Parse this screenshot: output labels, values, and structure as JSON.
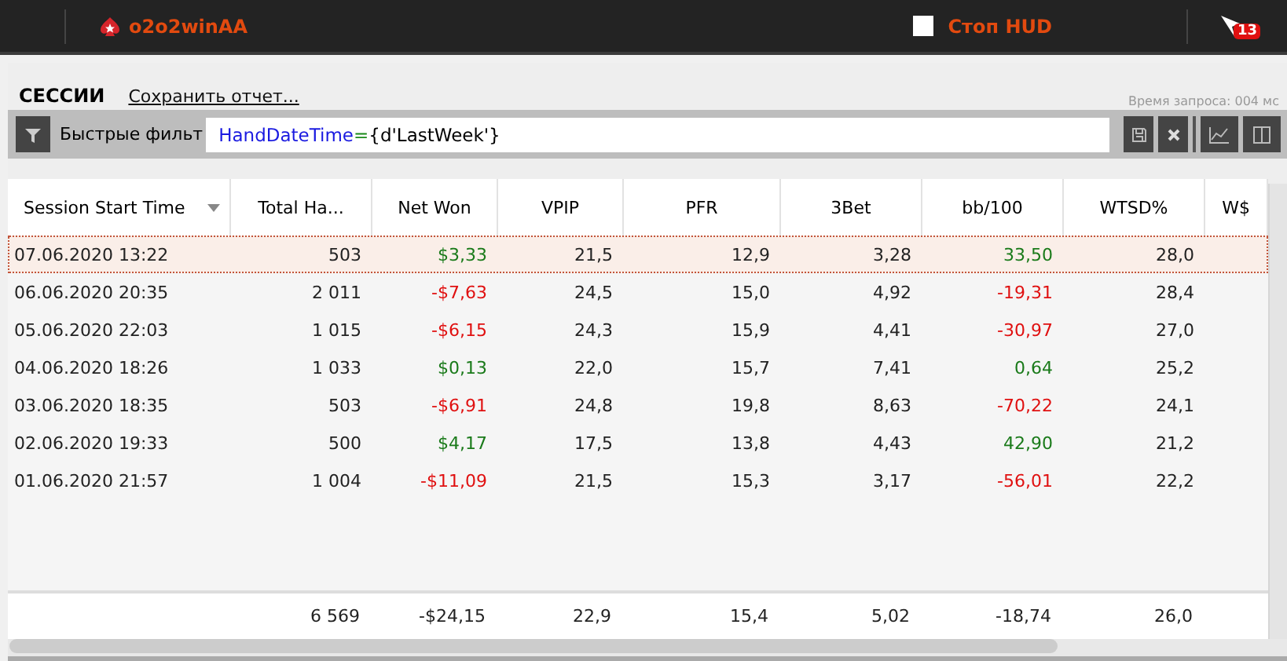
{
  "top_bar": {
    "account": "o2o2winAA",
    "hud_checked": false,
    "hud_label": "Стоп HUD",
    "notification_count": "13"
  },
  "header": {
    "title": "СЕССИИ",
    "save_link": "Сохранить отчет...",
    "query_time": "Время запроса: 004 мс"
  },
  "filter": {
    "label": "Быстрые фильт",
    "field": "HandDateTime",
    "operator": "=",
    "value": "{d'LastWeek'}"
  },
  "table": {
    "columns": [
      {
        "label": "Session Start Time",
        "sorted": true
      },
      {
        "label": "Total Ha...",
        "sorted": false
      },
      {
        "label": "Net Won",
        "sorted": false
      },
      {
        "label": "VPIP",
        "sorted": false
      },
      {
        "label": "PFR",
        "sorted": false
      },
      {
        "label": "3Bet",
        "sorted": false
      },
      {
        "label": "bb/100",
        "sorted": false
      },
      {
        "label": "WTSD%",
        "sorted": false
      },
      {
        "label": "W$",
        "sorted": false
      }
    ],
    "rows": [
      {
        "selected": true,
        "cells": [
          {
            "text": "07.06.2020 13:22"
          },
          {
            "text": "503"
          },
          {
            "text": "$3,33",
            "negative": false
          },
          {
            "text": "21,5"
          },
          {
            "text": "12,9"
          },
          {
            "text": "3,28"
          },
          {
            "text": "33,50",
            "negative": false
          },
          {
            "text": "28,0"
          }
        ]
      },
      {
        "selected": false,
        "cells": [
          {
            "text": "06.06.2020 20:35"
          },
          {
            "text": "2 011"
          },
          {
            "text": "-$7,63",
            "negative": true
          },
          {
            "text": "24,5"
          },
          {
            "text": "15,0"
          },
          {
            "text": "4,92"
          },
          {
            "text": "-19,31",
            "negative": true
          },
          {
            "text": "28,4"
          }
        ]
      },
      {
        "selected": false,
        "cells": [
          {
            "text": "05.06.2020 22:03"
          },
          {
            "text": "1 015"
          },
          {
            "text": "-$6,15",
            "negative": true
          },
          {
            "text": "24,3"
          },
          {
            "text": "15,9"
          },
          {
            "text": "4,41"
          },
          {
            "text": "-30,97",
            "negative": true
          },
          {
            "text": "27,0"
          }
        ]
      },
      {
        "selected": false,
        "cells": [
          {
            "text": "04.06.2020 18:26"
          },
          {
            "text": "1 033"
          },
          {
            "text": "$0,13",
            "negative": false
          },
          {
            "text": "22,0"
          },
          {
            "text": "15,7"
          },
          {
            "text": "7,41"
          },
          {
            "text": "0,64",
            "negative": false
          },
          {
            "text": "25,2"
          }
        ]
      },
      {
        "selected": false,
        "cells": [
          {
            "text": "03.06.2020 18:35"
          },
          {
            "text": "503"
          },
          {
            "text": "-$6,91",
            "negative": true
          },
          {
            "text": "24,8"
          },
          {
            "text": "19,8"
          },
          {
            "text": "8,63"
          },
          {
            "text": "-70,22",
            "negative": true
          },
          {
            "text": "24,1"
          }
        ]
      },
      {
        "selected": false,
        "cells": [
          {
            "text": "02.06.2020 19:33"
          },
          {
            "text": "500"
          },
          {
            "text": "$4,17",
            "negative": false
          },
          {
            "text": "17,5"
          },
          {
            "text": "13,8"
          },
          {
            "text": "4,43"
          },
          {
            "text": "42,90",
            "negative": false
          },
          {
            "text": "21,2"
          }
        ]
      },
      {
        "selected": false,
        "cells": [
          {
            "text": "01.06.2020 21:57"
          },
          {
            "text": "1 004"
          },
          {
            "text": "-$11,09",
            "negative": true
          },
          {
            "text": "21,5"
          },
          {
            "text": "15,3"
          },
          {
            "text": "3,17"
          },
          {
            "text": "-56,01",
            "negative": true
          },
          {
            "text": "22,2"
          }
        ]
      }
    ],
    "totals": [
      "6 569",
      "-$24,15",
      "22,9",
      "15,4",
      "5,02",
      "-18,74",
      "26,0"
    ]
  }
}
